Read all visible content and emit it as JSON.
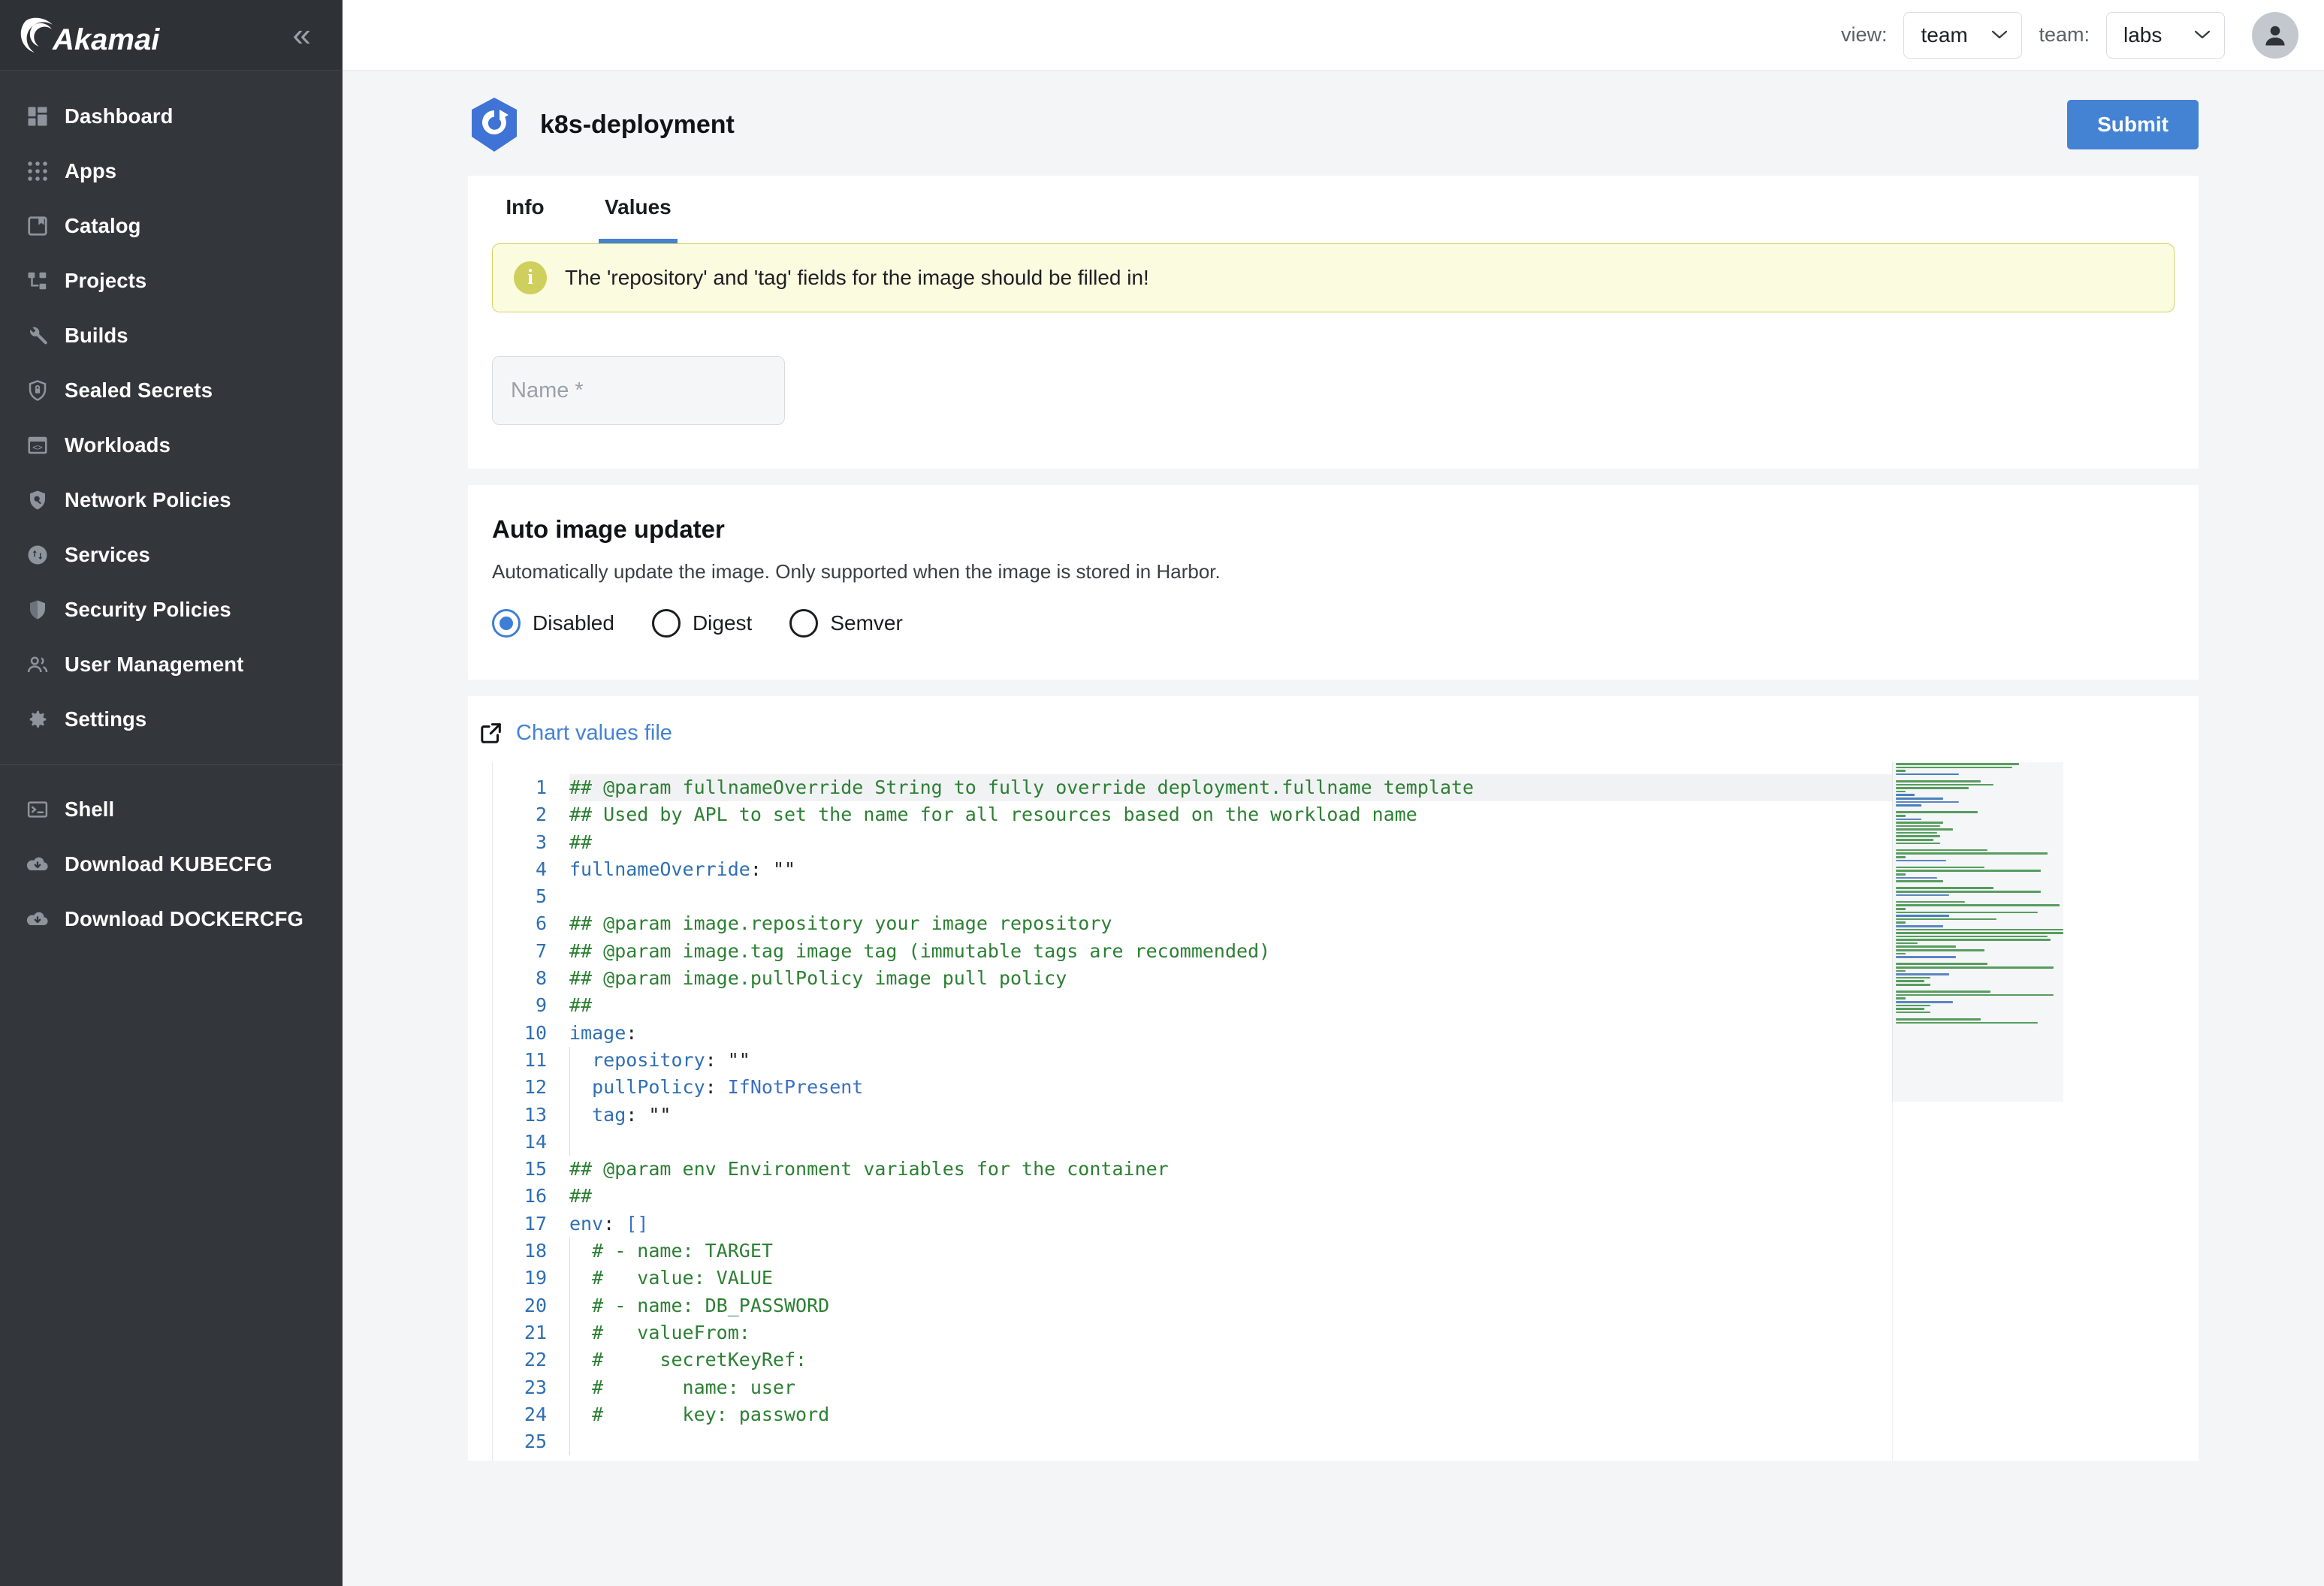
{
  "sidebar": {
    "brand": "Akamai",
    "collapse_icon": "chevron-double-left-icon",
    "items": [
      {
        "label": "Dashboard",
        "icon": "dashboard-icon"
      },
      {
        "label": "Apps",
        "icon": "apps-grid-icon"
      },
      {
        "label": "Catalog",
        "icon": "catalog-book-icon"
      },
      {
        "label": "Projects",
        "icon": "projects-tree-icon"
      },
      {
        "label": "Builds",
        "icon": "wrench-icon"
      },
      {
        "label": "Sealed Secrets",
        "icon": "shield-lock-icon"
      },
      {
        "label": "Workloads",
        "icon": "code-window-icon"
      },
      {
        "label": "Network Policies",
        "icon": "shield-search-icon"
      },
      {
        "label": "Services",
        "icon": "services-arrows-icon"
      },
      {
        "label": "Security Policies",
        "icon": "shield-icon"
      },
      {
        "label": "User Management",
        "icon": "users-icon"
      },
      {
        "label": "Settings",
        "icon": "gear-icon"
      }
    ],
    "footer_items": [
      {
        "label": "Shell",
        "icon": "terminal-icon"
      },
      {
        "label": "Download KUBECFG",
        "icon": "cloud-download-icon"
      },
      {
        "label": "Download DOCKERCFG",
        "icon": "cloud-download-icon"
      }
    ]
  },
  "topbar": {
    "view_label": "view:",
    "view_value": "team",
    "team_label": "team:",
    "team_value": "labs",
    "caret_icon": "chevron-down-icon",
    "avatar_icon": "user-avatar-icon"
  },
  "page": {
    "title": "k8s-deployment",
    "app_icon": "kubernetes-icon",
    "submit_label": "Submit"
  },
  "tabs": [
    {
      "label": "Info",
      "active": false
    },
    {
      "label": "Values",
      "active": true
    }
  ],
  "alert": {
    "icon": "info-icon",
    "text": "The 'repository' and 'tag' fields for the image should be filled in!"
  },
  "form": {
    "name_placeholder": "Name *"
  },
  "updater": {
    "title": "Auto image updater",
    "description": "Automatically update the image. Only supported when the image is stored in Harbor.",
    "options": [
      {
        "label": "Disabled",
        "selected": true
      },
      {
        "label": "Digest",
        "selected": false
      },
      {
        "label": "Semver",
        "selected": false
      }
    ]
  },
  "editor": {
    "link_label": "Chart values file",
    "link_icon": "external-link-icon",
    "lines": [
      {
        "n": 1,
        "text": "## @param fullnameOverride String to fully override deployment.fullname template",
        "kind": "comment",
        "highlight": true
      },
      {
        "n": 2,
        "text": "## Used by APL to set the name for all resources based on the workload name",
        "kind": "comment"
      },
      {
        "n": 3,
        "text": "##",
        "kind": "comment"
      },
      {
        "n": 4,
        "text": "fullnameOverride: \"\"",
        "kind": "key"
      },
      {
        "n": 5,
        "text": "",
        "kind": "blank"
      },
      {
        "n": 6,
        "text": "## @param image.repository your image repository",
        "kind": "comment"
      },
      {
        "n": 7,
        "text": "## @param image.tag image tag (immutable tags are recommended)",
        "kind": "comment"
      },
      {
        "n": 8,
        "text": "## @param image.pullPolicy image pull policy",
        "kind": "comment"
      },
      {
        "n": 9,
        "text": "##",
        "kind": "comment"
      },
      {
        "n": 10,
        "text": "image:",
        "kind": "key"
      },
      {
        "n": 11,
        "text": "  repository: \"\"",
        "kind": "key"
      },
      {
        "n": 12,
        "text": "  pullPolicy: IfNotPresent",
        "kind": "keyvalue"
      },
      {
        "n": 13,
        "text": "  tag: \"\"",
        "kind": "key"
      },
      {
        "n": 14,
        "text": "",
        "kind": "blank"
      },
      {
        "n": 15,
        "text": "## @param env Environment variables for the container",
        "kind": "comment"
      },
      {
        "n": 16,
        "text": "##",
        "kind": "comment"
      },
      {
        "n": 17,
        "text": "env: []",
        "kind": "keybracket"
      },
      {
        "n": 18,
        "text": "  # - name: TARGET",
        "kind": "comment"
      },
      {
        "n": 19,
        "text": "  #   value: VALUE",
        "kind": "comment"
      },
      {
        "n": 20,
        "text": "  # - name: DB_PASSWORD",
        "kind": "comment"
      },
      {
        "n": 21,
        "text": "  #   valueFrom:",
        "kind": "comment"
      },
      {
        "n": 22,
        "text": "  #     secretKeyRef:",
        "kind": "comment"
      },
      {
        "n": 23,
        "text": "  #       name: user",
        "kind": "comment"
      },
      {
        "n": 24,
        "text": "  #       key: password",
        "kind": "comment"
      },
      {
        "n": 25,
        "text": "",
        "kind": "blank"
      }
    ],
    "minimap_icon": "minimap"
  },
  "colors": {
    "accent": "#4482d4",
    "sidebar_bg": "#33363b",
    "alert_bg": "#fbfbe0",
    "alert_border": "#d4d46a",
    "comment_green": "#2c8033",
    "key_blue": "#2f6fb3"
  }
}
